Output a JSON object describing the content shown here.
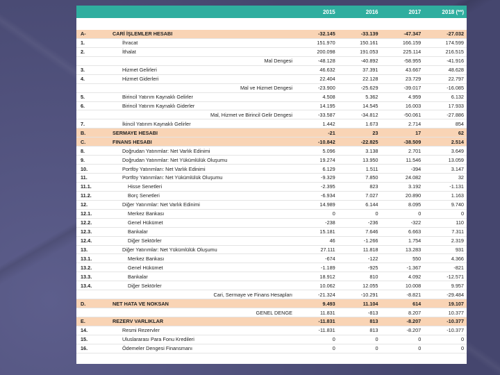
{
  "years": [
    "2015",
    "2016",
    "2017",
    "2018 (**)"
  ],
  "rows": [
    {
      "code": "A-",
      "label": "CARİ İŞLEMLER HESABI",
      "values": [
        "-32.145",
        "-33.139",
        "-47.347",
        "-27.032"
      ],
      "style": "hl"
    },
    {
      "code": "1.",
      "label": "İhracat",
      "values": [
        "151.970",
        "150.161",
        "166.159",
        "174.599"
      ],
      "style": "ind1"
    },
    {
      "code": "2.",
      "label": "İthalat",
      "values": [
        "200.098",
        "191.053",
        "225.114",
        "216.515"
      ],
      "style": "ind1"
    },
    {
      "code": "",
      "label": "Mal Dengesi",
      "values": [
        "-48.128",
        "-40.892",
        "-58.955",
        "-41.916"
      ],
      "style": "right"
    },
    {
      "code": "3.",
      "label": "Hizmet Gelirleri",
      "values": [
        "46.632",
        "37.391",
        "43.667",
        "48.628"
      ],
      "style": "ind1"
    },
    {
      "code": "4.",
      "label": "Hizmet Giderleri",
      "values": [
        "22.404",
        "22.128",
        "23.729",
        "22.797"
      ],
      "style": "ind1"
    },
    {
      "code": "",
      "label": "Mal ve Hizmet Dengesi",
      "values": [
        "-23.900",
        "-25.629",
        "-39.017",
        "-16.085"
      ],
      "style": "right"
    },
    {
      "code": "5.",
      "label": "Birincil Yatırım Kaynaklı Gelirler",
      "values": [
        "4.508",
        "5.362",
        "4.959",
        "6.132"
      ],
      "style": "ind1"
    },
    {
      "code": "6.",
      "label": "Birincil Yatırım Kaynaklı Giderler",
      "values": [
        "14.195",
        "14.545",
        "16.003",
        "17.933"
      ],
      "style": "ind1"
    },
    {
      "code": "",
      "label": "Mal, Hizmet ve Birincil Gelir Dengesi",
      "values": [
        "-33.587",
        "-34.812",
        "-50.061",
        "-27.886"
      ],
      "style": "right"
    },
    {
      "code": "7.",
      "label": "İkincil Yatırım Kaynaklı Gelirler",
      "values": [
        "1.442",
        "1.673",
        "2.714",
        "854"
      ],
      "style": "ind1"
    },
    {
      "code": "B.",
      "label": "SERMAYE HESABI",
      "values": [
        "-21",
        "23",
        "17",
        "62"
      ],
      "style": "hl"
    },
    {
      "code": "C.",
      "label": "FINANS HESABI",
      "values": [
        "-10.842",
        "-22.825",
        "-38.509",
        "2.514"
      ],
      "style": "hl"
    },
    {
      "code": "8.",
      "label": "Doğrudan Yatırımlar: Net Varlık Edinimi",
      "values": [
        "5.096",
        "3.138",
        "2.701",
        "3.649"
      ],
      "style": "ind1"
    },
    {
      "code": "9.",
      "label": "Doğrudan Yatırımlar: Net Yükümlülük Oluşumu",
      "values": [
        "19.274",
        "13.950",
        "11.546",
        "13.059"
      ],
      "style": "ind1"
    },
    {
      "code": "10.",
      "label": "Portföy Yatırımları: Net Varlık Edinimi",
      "values": [
        "6.129",
        "1.511",
        "-394",
        "3.147"
      ],
      "style": "ind1"
    },
    {
      "code": "11.",
      "label": "Portföy Yatırımları: Net Yükümlülük Oluşumu",
      "values": [
        "-9.329",
        "7.850",
        "24.082",
        "32"
      ],
      "style": "ind1"
    },
    {
      "code": "11.1.",
      "label": "Hisse Senetleri",
      "values": [
        "-2.395",
        "823",
        "3.192",
        "-1.131"
      ],
      "style": "ind2"
    },
    {
      "code": "11.2.",
      "label": "Borç Senetleri",
      "values": [
        "-6.934",
        "7.027",
        "20.890",
        "1.163"
      ],
      "style": "ind2"
    },
    {
      "code": "12.",
      "label": "Diğer Yatırımlar: Net Varlık Edinimi",
      "values": [
        "14.989",
        "6.144",
        "8.095",
        "9.740"
      ],
      "style": "ind1"
    },
    {
      "code": "12.1.",
      "label": "Merkez Bankası",
      "values": [
        "0",
        "0",
        "0",
        "0"
      ],
      "style": "ind2"
    },
    {
      "code": "12.2.",
      "label": "Genel Hükümet",
      "values": [
        "-238",
        "-236",
        "-322",
        "110"
      ],
      "style": "ind2"
    },
    {
      "code": "12.3.",
      "label": "Bankalar",
      "values": [
        "15.181",
        "7.646",
        "6.663",
        "7.311"
      ],
      "style": "ind2"
    },
    {
      "code": "12.4.",
      "label": "Diğer Sektörler",
      "values": [
        "46",
        "-1.266",
        "1.754",
        "2.319"
      ],
      "style": "ind2"
    },
    {
      "code": "13.",
      "label": "Diğer Yatırımlar: Net Yükümlülük Oluşumu",
      "values": [
        "27.111",
        "11.818",
        "13.283",
        "931"
      ],
      "style": "ind1"
    },
    {
      "code": "13.1.",
      "label": "Merkez Bankası",
      "values": [
        "-674",
        "-122",
        "550",
        "4.366"
      ],
      "style": "ind2"
    },
    {
      "code": "13.2.",
      "label": "Genel Hükümet",
      "values": [
        "-1.189",
        "-925",
        "-1.367",
        "-821"
      ],
      "style": "ind2"
    },
    {
      "code": "13.3.",
      "label": "Bankalar",
      "values": [
        "18.912",
        "810",
        "4.092",
        "-12.571"
      ],
      "style": "ind2"
    },
    {
      "code": "13.4.",
      "label": "Diğer Sektörler",
      "values": [
        "10.062",
        "12.055",
        "10.008",
        "9.957"
      ],
      "style": "ind2"
    },
    {
      "code": "",
      "label": "Cari, Sermaye ve Finans Hesapları",
      "values": [
        "-21.324",
        "-10.291",
        "-8.821",
        "-29.484"
      ],
      "style": "right"
    },
    {
      "code": "D.",
      "label": "NET HATA VE NOKSAN",
      "values": [
        "9.493",
        "11.104",
        "614",
        "19.107"
      ],
      "style": "hl"
    },
    {
      "code": "",
      "label": "GENEL DENGE",
      "values": [
        "11.831",
        "-813",
        "8.207",
        "10.377"
      ],
      "style": "right"
    },
    {
      "code": "E.",
      "label": "REZERV VARLIKLAR",
      "values": [
        "-11.831",
        "813",
        "-8.207",
        "-10.377"
      ],
      "style": "hl"
    },
    {
      "code": "14.",
      "label": "Resmi Rezervler",
      "values": [
        "-11.831",
        "813",
        "-8.207",
        "-10.377"
      ],
      "style": "ind1"
    },
    {
      "code": "15.",
      "label": "Uluslararası Para Fonu Kredileri",
      "values": [
        "0",
        "0",
        "0",
        "0"
      ],
      "style": "ind1"
    },
    {
      "code": "16.",
      "label": "Ödemeler Dengesi Finansmanı",
      "values": [
        "0",
        "0",
        "0",
        "0"
      ],
      "style": "ind1"
    }
  ]
}
